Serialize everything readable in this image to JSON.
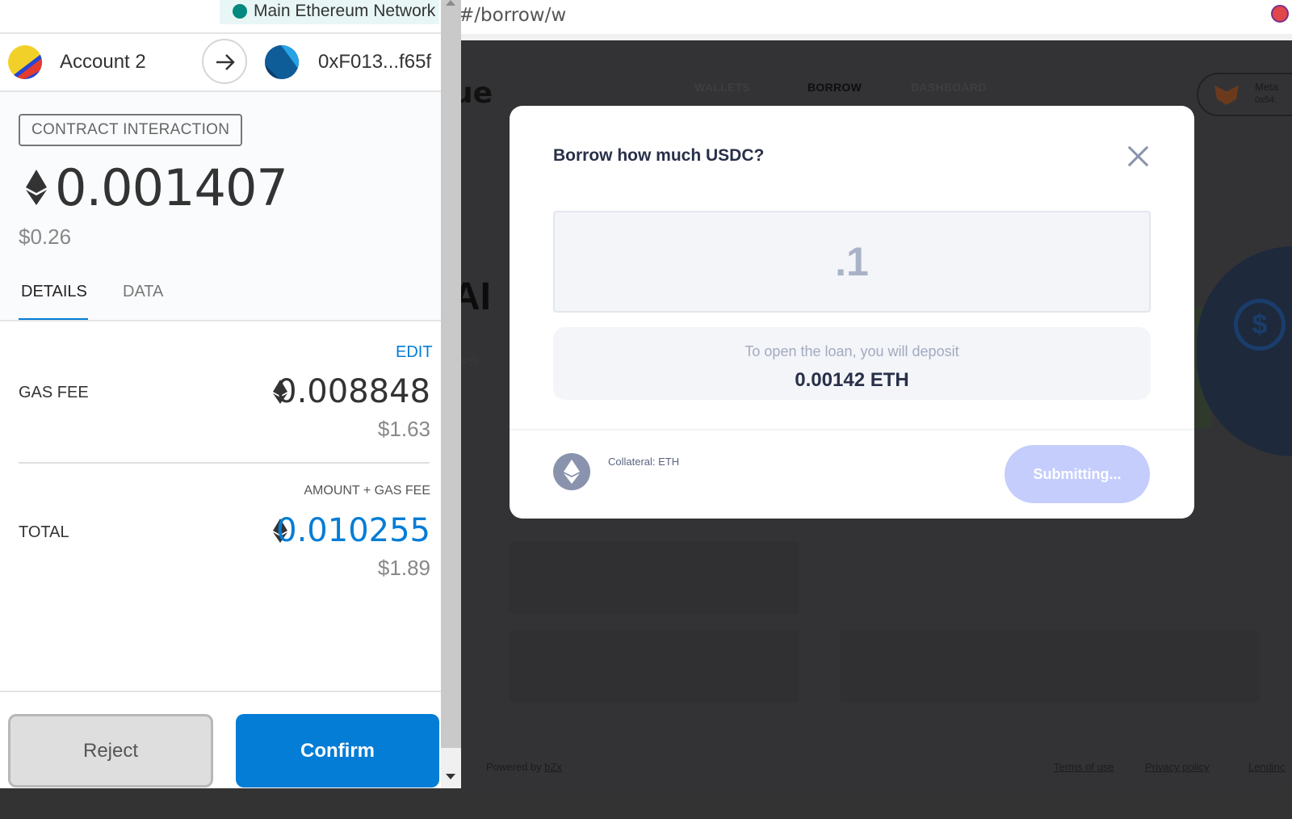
{
  "browser": {
    "url": "#/borrow/w"
  },
  "background_app": {
    "logo_fragment": "ue",
    "nav": [
      "WALLETS",
      "BORROW",
      "DASHBOARD"
    ],
    "active_nav": "BORROW",
    "wallet_name": "Meta",
    "wallet_addr": "0x54:",
    "hero_text": "AI",
    "apr_text": "APR",
    "footer": {
      "powered_by": "Powered by",
      "powered_link": "bZx",
      "links": [
        "Terms of use",
        "Privacy policy",
        "Lendinc"
      ]
    }
  },
  "modal": {
    "title": "Borrow how much USDC?",
    "amount_value": ".1",
    "deposit_label": "To open the loan, you will deposit",
    "deposit_value": "0.00142 ETH",
    "collateral_label": "Collateral: ETH",
    "submit_label": "Submitting..."
  },
  "metamask": {
    "network": "Main Ethereum Network",
    "network_color": "#03897e",
    "from_account": "Account 2",
    "to_address": "0xF013...f65f",
    "badge": "CONTRACT INTERACTION",
    "amount_eth": "0.001407",
    "amount_usd": "$0.26",
    "tabs": [
      "DETAILS",
      "DATA"
    ],
    "active_tab": "DETAILS",
    "edit_label": "EDIT",
    "gas_fee_label": "GAS FEE",
    "gas_fee_eth": "0.008848",
    "gas_fee_usd": "$1.63",
    "amount_gas_label": "AMOUNT + GAS FEE",
    "total_label": "TOTAL",
    "total_eth": "0.010255",
    "total_usd": "$1.89",
    "total_color": "#037dd6",
    "reject_label": "Reject",
    "confirm_label": "Confirm"
  }
}
